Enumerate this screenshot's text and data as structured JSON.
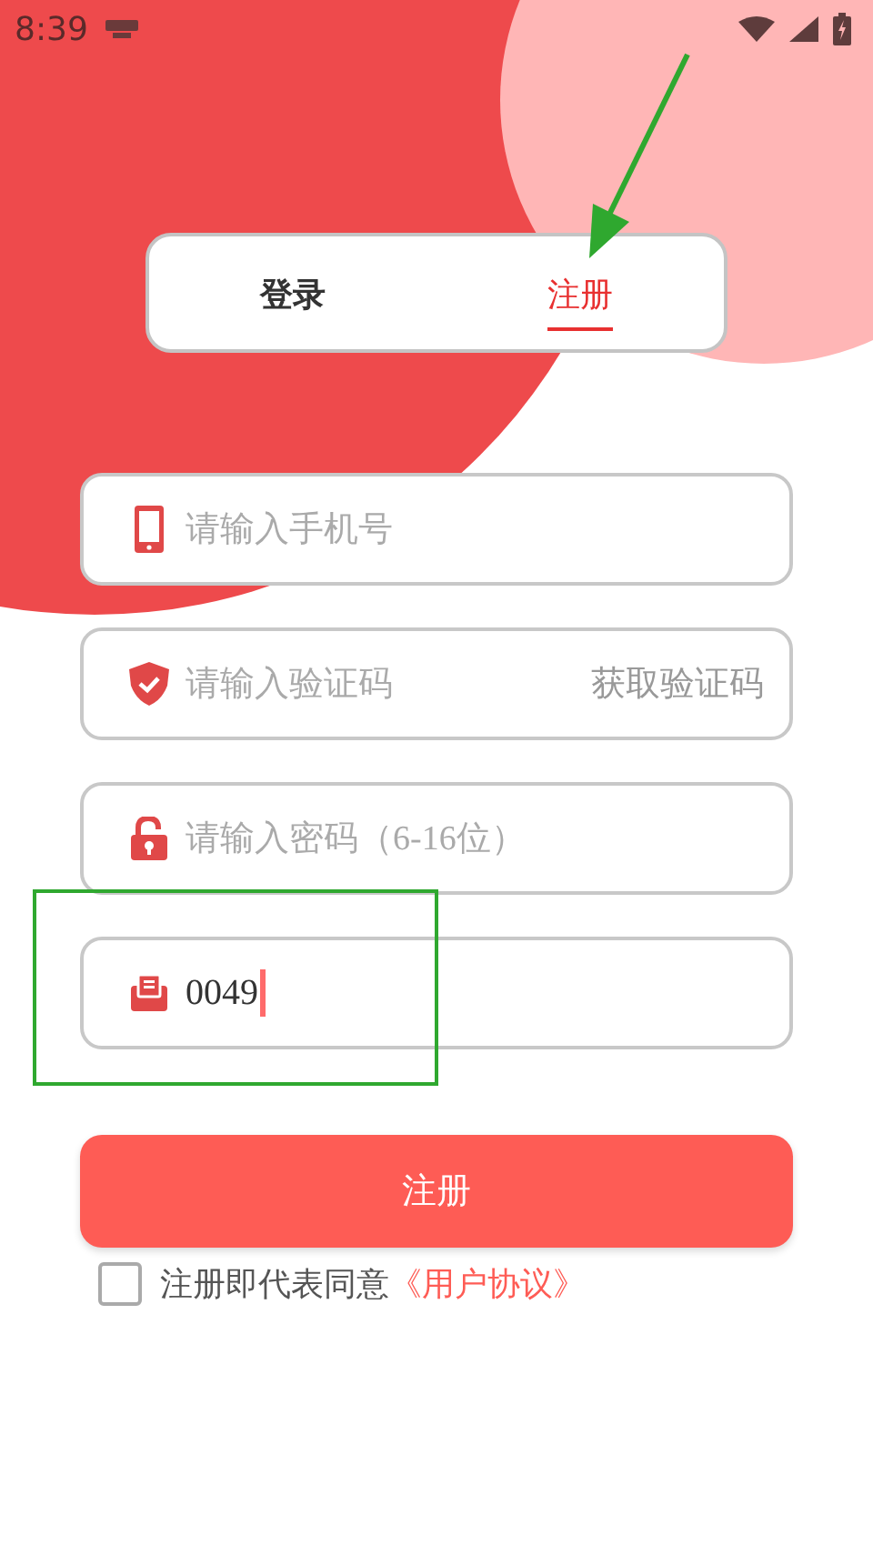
{
  "status_bar": {
    "time": "8:39"
  },
  "tabs": [
    {
      "label": "登录",
      "selected": false
    },
    {
      "label": "注册",
      "selected": true
    }
  ],
  "fields": [
    {
      "placeholder": "请输入手机号"
    },
    {
      "placeholder": "请输入验证码",
      "action": "获取验证码"
    },
    {
      "placeholder": "请输入密码（6-16位）"
    },
    {
      "value": "0049",
      "focused": true
    }
  ],
  "submit": "注册",
  "agreement": {
    "checked": false,
    "text": "注册即代表同意",
    "link": "《用户协议》"
  }
}
